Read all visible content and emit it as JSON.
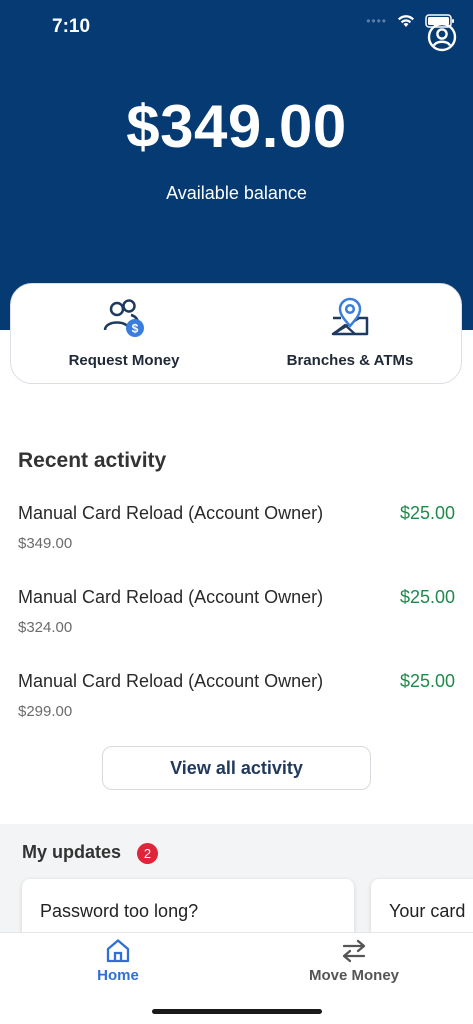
{
  "status": {
    "time": "7:10"
  },
  "balance": {
    "amount": "$349.00",
    "label": "Available balance"
  },
  "actions": [
    {
      "label": "Request Money",
      "icon": "request-money-icon"
    },
    {
      "label": "Branches & ATMs",
      "icon": "map-pin-icon"
    }
  ],
  "recent": {
    "title": "Recent activity",
    "items": [
      {
        "description": "Manual Card Reload (Account Owner)",
        "amount": "$25.00",
        "balance": "$349.00"
      },
      {
        "description": "Manual Card Reload (Account Owner)",
        "amount": "$25.00",
        "balance": "$324.00"
      },
      {
        "description": "Manual Card Reload (Account Owner)",
        "amount": "$25.00",
        "balance": "$299.00"
      }
    ],
    "view_all": "View all activity"
  },
  "updates": {
    "title": "My updates",
    "count": "2",
    "cards": [
      {
        "title": "Password too long?"
      },
      {
        "title": "Your card"
      }
    ]
  },
  "tabs": [
    {
      "label": "Home",
      "icon": "home-icon",
      "active": true
    },
    {
      "label": "Move Money",
      "icon": "transfer-arrows-icon",
      "active": false
    }
  ],
  "colors": {
    "brand_navy": "#053a73",
    "positive_green": "#1f8a4c",
    "active_tab_blue": "#2f6fd6",
    "badge_red": "#e0243a"
  }
}
